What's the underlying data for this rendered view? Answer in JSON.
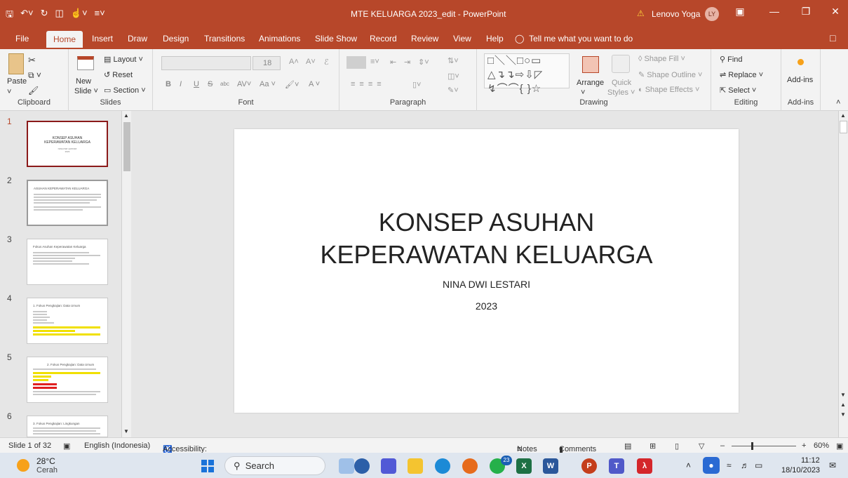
{
  "titlebar": {
    "doc_title": "MTE KELUARGA 2023_edit  -  PowerPoint",
    "user_name": "Lenovo Yoga",
    "user_initials": "LY"
  },
  "tabs": [
    "File",
    "Home",
    "Insert",
    "Draw",
    "Design",
    "Transitions",
    "Animations",
    "Slide Show",
    "Record",
    "Review",
    "View",
    "Help"
  ],
  "active_tab": "Home",
  "tell_me": "Tell me what you want to do",
  "ribbon": {
    "clipboard": {
      "paste": "Paste",
      "label": "Clipboard"
    },
    "slides": {
      "new_slide_1": "New",
      "new_slide_2": "Slide ˅",
      "layout": "Layout ˅",
      "reset": "Reset",
      "section": "Section ˅",
      "label": "Slides"
    },
    "font": {
      "size": "18",
      "label": "Font",
      "bold": "B",
      "italic": "I",
      "underline": "U",
      "strike": "S",
      "shadow": "abc",
      "case": "Aa ˅",
      "grow": "A˄",
      "shrink": "A˅"
    },
    "paragraph": {
      "label": "Paragraph"
    },
    "drawing": {
      "arrange": "Arrange",
      "quick_styles_1": "Quick",
      "quick_styles_2": "Styles ˅",
      "shape_fill": "Shape Fill ˅",
      "shape_outline": "Shape Outline ˅",
      "shape_effects": "Shape Effects ˅",
      "label": "Drawing"
    },
    "editing": {
      "find": "Find",
      "replace": "Replace ˅",
      "select": "Select ˅",
      "label": "Editing"
    },
    "addins": {
      "button": "Add-ins",
      "label": "Add-ins"
    }
  },
  "thumbnails": [
    {
      "num": "1",
      "title_1": "KONSEP ASUHAN",
      "title_2": "KEPERAWATAN KELUARGA",
      "sub_1": "NINA DWI LESTARI",
      "sub_2": "2023"
    },
    {
      "num": "2",
      "heading": "ASUHAN KEPERAWATAN KELUARGA"
    },
    {
      "num": "3",
      "heading": "Fokus Asuhan Keperawatan Keluarga"
    },
    {
      "num": "4",
      "heading": "1. Fokus Pengkajian: Data Umum"
    },
    {
      "num": "5",
      "heading": "2. Fokus Pengkajian: Data Umum"
    },
    {
      "num": "6",
      "heading": "3. Fokus Pengkajian: Lingkungan"
    }
  ],
  "slide": {
    "title_line1": "KONSEP ASUHAN",
    "title_line2": "KEPERAWATAN KELUARGA",
    "subtitle": "NINA DWI LESTARI",
    "year": "2023"
  },
  "status": {
    "slide_info": "Slide 1 of 32",
    "language": "English (Indonesia)",
    "accessibility": "Accessibility: Investigate",
    "notes": "Notes",
    "comments": "Comments",
    "zoom": "60%"
  },
  "taskbar": {
    "temperature": "28°C",
    "condition": "Cerah",
    "search": "Search",
    "whatsapp_badge": "23",
    "time": "11:12",
    "date": "18/10/2023"
  },
  "colors": {
    "accent": "#b7472a",
    "ribbon": "#f3f3f3",
    "workspace": "#e6e6e6"
  }
}
